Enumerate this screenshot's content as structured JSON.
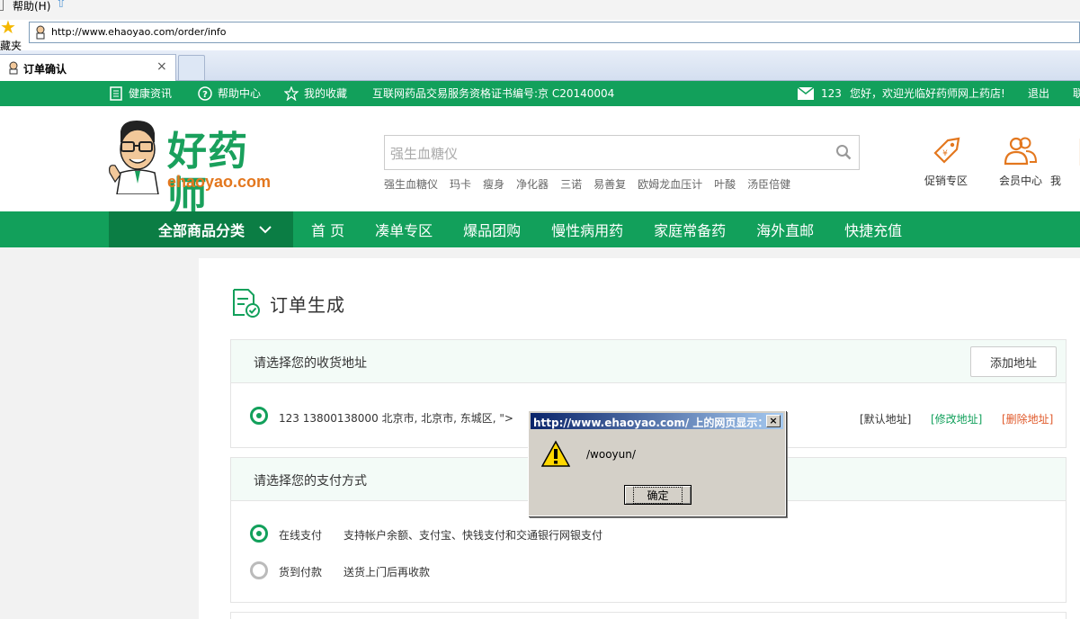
{
  "browser": {
    "menu_help": "帮助(H)",
    "favorites_label": "藏夹",
    "url": "http://www.ehaoyao.com/order/info",
    "tab_title": "订单确认",
    "tab_close": "×"
  },
  "topbar": {
    "health_info": "健康资讯",
    "help_center": "帮助中心",
    "my_favorites": "我的收藏",
    "license": "互联网药品交易服务资格证书编号:京 C20140004",
    "user": "123",
    "welcome": "您好，欢迎光临好药师网上药店!",
    "logout": "退出",
    "cut_edge": "联"
  },
  "logo": {
    "cn": "好药师",
    "en": "ehaoyao.com"
  },
  "search": {
    "placeholder": "强生血糖仪",
    "hot_words": [
      "强生血糖仪",
      "玛卡",
      "瘦身",
      "净化器",
      "三诺",
      "易善复",
      "欧姆龙血压计",
      "叶酸",
      "汤臣倍健"
    ]
  },
  "header_buttons": {
    "promo": "促销专区",
    "member": "会员中心",
    "cut": "我"
  },
  "nav": {
    "all_categories": "全部商品分类",
    "items": [
      "首 页",
      "凑单专区",
      "爆品团购",
      "慢性病用药",
      "家庭常备药",
      "海外直邮",
      "快捷充值"
    ]
  },
  "order": {
    "title": "订单生成",
    "address_section": {
      "title": "请选择您的收货地址",
      "add_button": "添加地址",
      "address_text": "123  13800138000  北京市, 北京市, 东城区, \">",
      "default_link": "[默认地址]",
      "edit_link": "[修改地址]",
      "delete_link": "[删除地址]"
    },
    "payment_section": {
      "title": "请选择您的支付方式",
      "online_label": "在线支付",
      "online_desc": "支持帐户余额、支付宝、快钱支付和交通银行网银支付",
      "cod_label": "货到付款",
      "cod_desc": "送货上门后再收款"
    }
  },
  "dialog": {
    "title": "http://www.ehaoyao.com/ 上的网页显示：",
    "message": "/wooyun/",
    "ok": "确定",
    "close": "×"
  },
  "colors": {
    "brand_green": "#12a05b",
    "dark_green": "#0b7d44",
    "orange": "#e3771e",
    "link_green": "#12a05b",
    "link_red": "#e05a2b"
  }
}
